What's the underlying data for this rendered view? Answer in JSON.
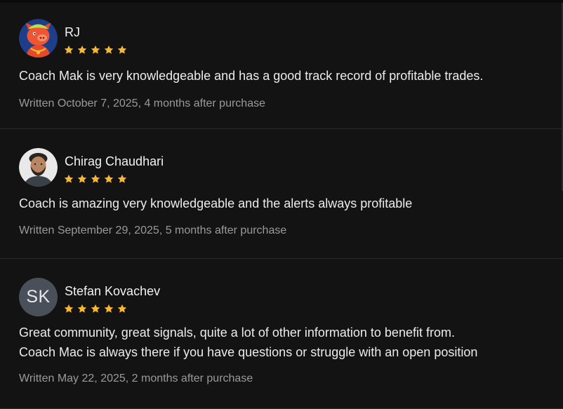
{
  "reviews": [
    {
      "name": "RJ",
      "avatar_type": "pig-cartoon",
      "rating": 5,
      "text_lines": [
        "Coach Mak is very knowledgeable and has a good track record of profitable trades."
      ],
      "meta": "Written October 7, 2025, 4 months after purchase"
    },
    {
      "name": "Chirag Chaudhari",
      "avatar_type": "photo",
      "rating": 5,
      "text_lines": [
        "Coach is amazing very knowledgeable and the alerts always profitable"
      ],
      "meta": "Written September 29, 2025, 5 months after purchase"
    },
    {
      "name": "Stefan Kovachev",
      "avatar_type": "initials",
      "avatar_initials": "SK",
      "rating": 5,
      "text_lines": [
        "Great community, great signals, quite a lot of other information to benefit from.",
        "Coach Mac is always there if you have questions or struggle with an open position"
      ],
      "meta": "Written May 22, 2025, 2 months after purchase"
    }
  ],
  "colors": {
    "star": "#f7b731",
    "background": "#131313",
    "meta_text": "#9a9a9a"
  }
}
